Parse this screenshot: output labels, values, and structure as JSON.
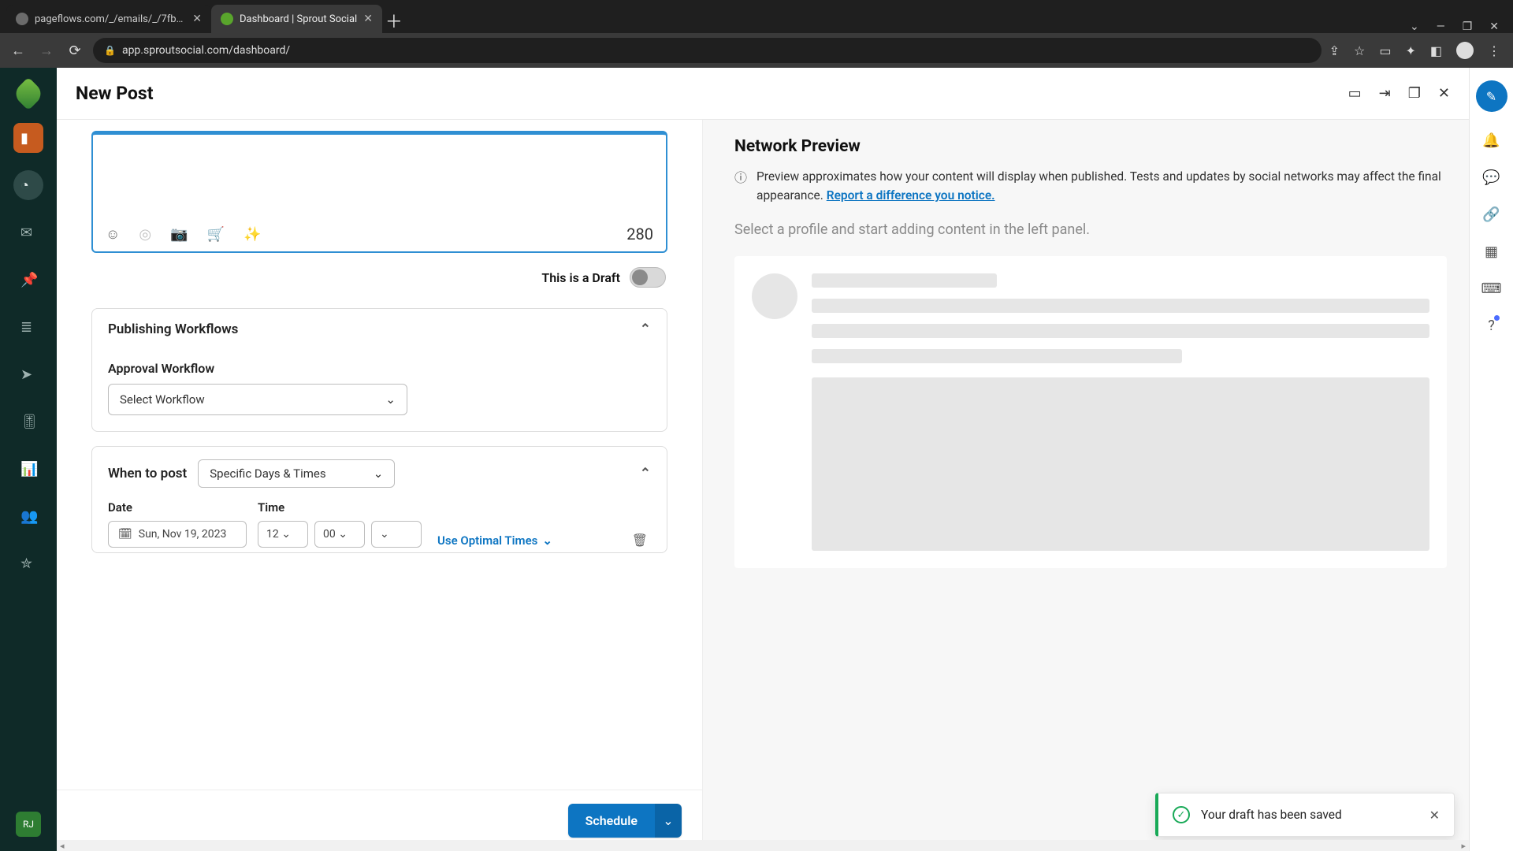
{
  "browser": {
    "tabs": [
      {
        "title": "pageflows.com/_/emails/_/7fb5c",
        "active": false
      },
      {
        "title": "Dashboard | Sprout Social",
        "active": true
      }
    ],
    "url": "app.sproutsocial.com/dashboard/"
  },
  "leftrail": {
    "avatar_initials": "RJ"
  },
  "header": {
    "title": "New Post"
  },
  "composer": {
    "char_count": "280",
    "draft_label": "This is a Draft"
  },
  "workflows": {
    "section_title": "Publishing Workflows",
    "approval_label": "Approval Workflow",
    "select_placeholder": "Select Workflow"
  },
  "when": {
    "label": "When to post",
    "mode": "Specific Days & Times",
    "date_label": "Date",
    "time_label": "Time",
    "date_value": "Sun, Nov 19, 2023",
    "time_hour": "12",
    "time_min": "00",
    "optimal_label": "Use Optimal Times"
  },
  "schedule_button": "Schedule",
  "preview": {
    "title": "Network Preview",
    "info_text": "Preview approximates how your content will display when published. Tests and updates by social networks may affect the final appearance. ",
    "info_link": "Report a difference you notice.",
    "empty_msg": "Select a profile and start adding content in the left panel."
  },
  "toast": {
    "message": "Your draft has been saved"
  }
}
